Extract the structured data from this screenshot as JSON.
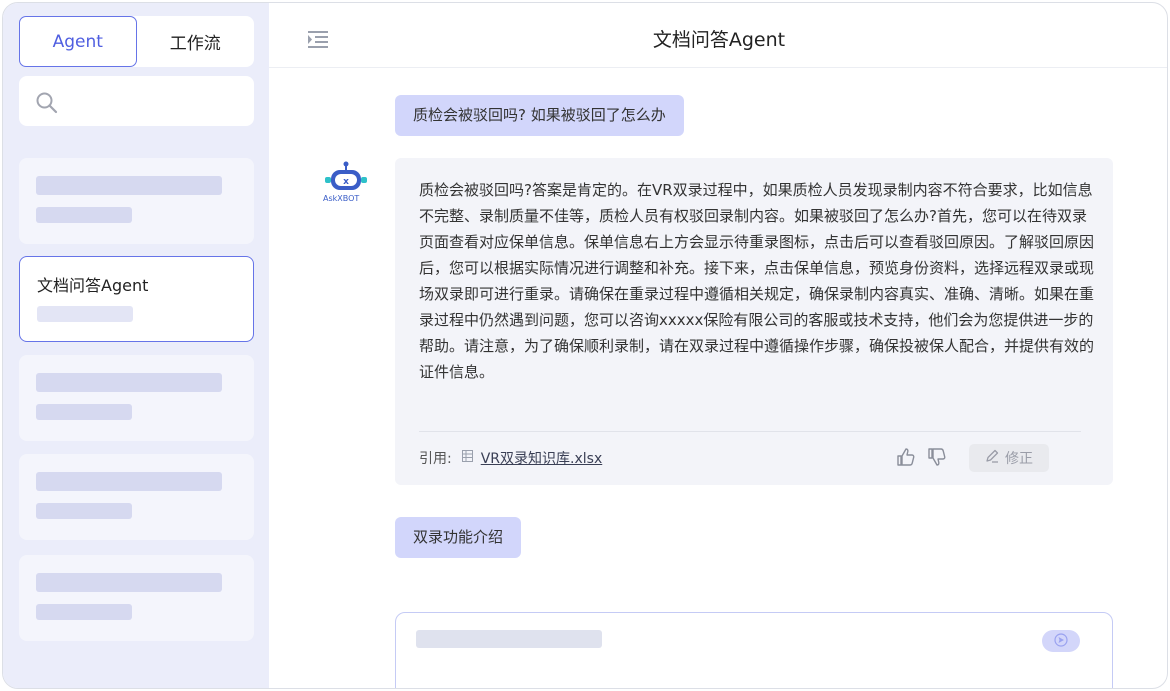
{
  "sidebar": {
    "tabs": [
      {
        "label": "Agent",
        "active": true
      },
      {
        "label": "工作流",
        "active": false
      }
    ],
    "search": {
      "placeholder": ""
    },
    "agents": [
      {
        "title": ""
      },
      {
        "title": "文档问答Agent",
        "active": true
      },
      {
        "title": ""
      },
      {
        "title": ""
      },
      {
        "title": ""
      }
    ]
  },
  "header": {
    "title": "文档问答Agent"
  },
  "chat": {
    "messages": [
      {
        "role": "user",
        "text": "质检会被驳回吗? 如果被驳回了怎么办"
      },
      {
        "role": "bot",
        "avatar_label": "AskXBOT",
        "text": "质检会被驳回吗?答案是肯定的。在VR双录过程中，如果质检人员发现录制内容不符合要求，比如信息不完整、录制质量不佳等，质检人员有权驳回录制内容。如果被驳回了怎么办?首先，您可以在待双录页面查看对应保单信息。保单信息右上方会显示待重录图标，点击后可以查看驳回原因。了解驳回原因后，您可以根据实际情况进行调整和补充。接下来，点击保单信息，预览身份资料，选择远程双录或现场双录即可进行重录。请确保在重录过程中遵循相关规定，确保录制内容真实、准确、清晰。如果在重录过程中仍然遇到问题，您可以咨询xxxxx保险有限公司的客服或技术支持，他们会为您提供进一步的帮助。请注意，为了确保顺利录制，请在双录过程中遵循操作步骤，确保投被保人配合，并提供有效的证件信息。",
        "cite_label": "引用:",
        "cite_file": "VR双录知识库.xlsx",
        "fix_label": "修正"
      },
      {
        "role": "user",
        "text": "双录功能介绍"
      }
    ]
  },
  "composer": {
    "placeholder": ""
  },
  "colors": {
    "accent": "#6674e8",
    "sidebar_bg": "#ebedfa",
    "user_bubble": "#d2d6fb",
    "answer_bg": "#f3f4f9"
  }
}
